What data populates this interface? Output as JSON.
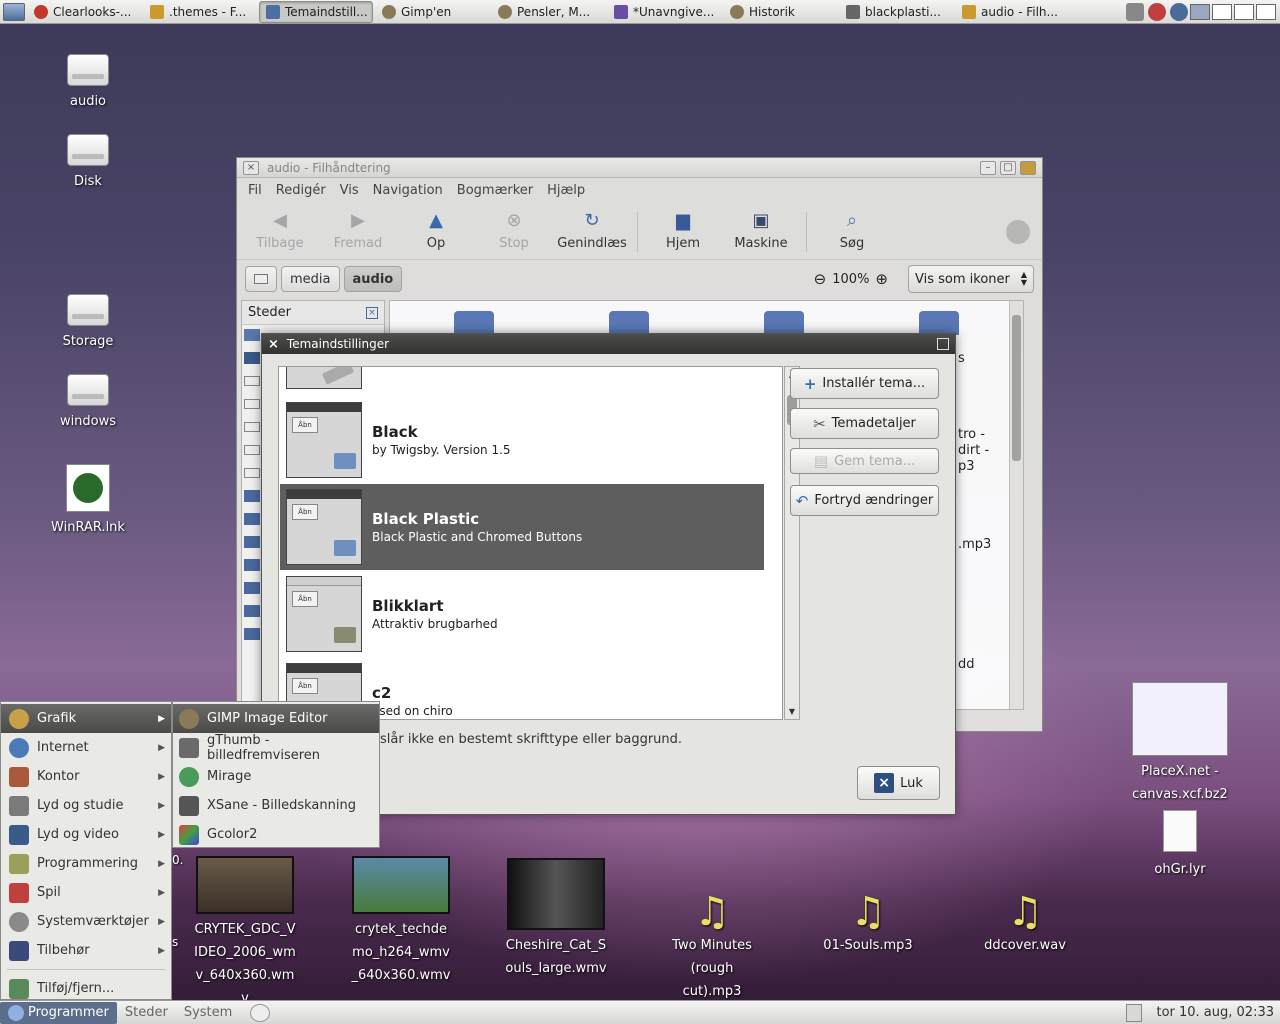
{
  "top_panel": {
    "tasks": [
      {
        "label": "Clearlooks-...",
        "icon": "firefox-icon",
        "color": "#c0392b"
      },
      {
        "label": ".themes - F...",
        "icon": "folder-icon",
        "color": "#c99a2e"
      },
      {
        "label": "Temaindstill...",
        "icon": "theme-icon",
        "color": "#4a6fa5"
      },
      {
        "label": "Gimp'en",
        "icon": "gimp-icon",
        "color": "#8a7a5a"
      },
      {
        "label": "Pensler, M...",
        "icon": "gimp-icon",
        "color": "#8a7a5a"
      },
      {
        "label": "*Unavngive...",
        "icon": "image-icon",
        "color": "#6a4fa5"
      },
      {
        "label": "Historik",
        "icon": "gimp-icon",
        "color": "#8a7a5a"
      },
      {
        "label": "blackplasti...",
        "icon": "image-icon",
        "color": "#666666"
      },
      {
        "label": "audio - Filh...",
        "icon": "folder-icon",
        "color": "#c99a2e"
      }
    ]
  },
  "desktop_icons": [
    {
      "label": "audio"
    },
    {
      "label": "Disk"
    },
    {
      "label": "Storage"
    },
    {
      "label": "windows"
    },
    {
      "label": "WinRAR.lnk"
    }
  ],
  "desktop_bottom_files": [
    {
      "label": "CRYTEK_GDC_VIDEO_2006_wmv_640x360.wmv"
    },
    {
      "label": "crytek_techdemo_h264_wmv_640x360.wmv"
    },
    {
      "label": "Cheshire_Cat_Souls_large.wmv"
    },
    {
      "label": "Two Minutes (rough cut).mp3"
    },
    {
      "label": "01-Souls.mp3"
    },
    {
      "label": "ddcover.wav"
    }
  ],
  "desktop_right_files": [
    {
      "label": "PlaceX.net - canvas.xcf.bz2"
    },
    {
      "label": "ohGr.lyr"
    }
  ],
  "file_manager": {
    "title": "audio - Filhåndtering",
    "menu": [
      "Fil",
      "Redigér",
      "Vis",
      "Navigation",
      "Bogmærker",
      "Hjælp"
    ],
    "toolbar": {
      "back": "Tilbage",
      "forward": "Fremad",
      "up": "Op",
      "stop": "Stop",
      "reload": "Genindlæs",
      "home": "Hjem",
      "computer": "Maskine",
      "search": "Søg"
    },
    "breadcrumbs": [
      "media",
      "audio"
    ],
    "zoom": "100%",
    "view_mode": "Vis som ikoner",
    "sidebar_title": "Steder",
    "content_fragments": {
      "f1": "s",
      "f2": "tro -",
      "f3": "dirt -",
      "f4": "p3",
      "f5": ".mp3",
      "f6": "dd"
    }
  },
  "theme_dialog": {
    "title": "Temaindstillinger",
    "themes": [
      {
        "name": "Black",
        "desc": "by Twigsby.  Version 1.5"
      },
      {
        "name": "Black Plastic",
        "desc": "Black Plastic and Chromed Buttons"
      },
      {
        "name": "Blikklart",
        "desc": "Attraktiv brugbarhed"
      },
      {
        "name": "c2",
        "desc": "ased on chiro"
      }
    ],
    "preview_label": "Åbn",
    "buttons": {
      "install": "Installér tema...",
      "details": "Temadetaljer",
      "save": "Gem tema...",
      "revert": "Fortryd ændringer"
    },
    "note": "slår ikke en bestemt skrifttype eller baggrund.",
    "close": "Luk"
  },
  "app_menu": {
    "items": [
      {
        "label": "Grafik",
        "color": "#c8a048"
      },
      {
        "label": "Internet",
        "color": "#4a7ab8"
      },
      {
        "label": "Kontor",
        "color": "#a85a3a"
      },
      {
        "label": "Lyd og studie",
        "color": "#7a7a7a"
      },
      {
        "label": "Lyd og video",
        "color": "#3a5a8a"
      },
      {
        "label": "Programmering",
        "color": "#9aa05a"
      },
      {
        "label": "Spil",
        "color": "#c04040"
      },
      {
        "label": "Systemværktøjer",
        "color": "#8a8a8a"
      },
      {
        "label": "Tilbehør",
        "color": "#3a4a7a"
      }
    ],
    "extra": {
      "label": "Tilføj/fjern...",
      "color": "#5a8a5a"
    }
  },
  "sub_menu": {
    "items": [
      {
        "label": "GIMP Image Editor",
        "color": "#8a7a5a"
      },
      {
        "label": "gThumb - billedfremviseren",
        "color": "#6a6a6a"
      },
      {
        "label": "Mirage",
        "color": "#4a9a5a"
      },
      {
        "label": "XSane - Billedskanning",
        "color": "#555555"
      },
      {
        "label": "Gcolor2",
        "color": "#40a040"
      }
    ]
  },
  "bottom_panel": {
    "programs": "Programmer",
    "places": "Steder",
    "system": "System",
    "clock": "tor 10. aug, 02:33"
  },
  "fragments": {
    "partial_0": "0.",
    "partial_s": "s"
  }
}
